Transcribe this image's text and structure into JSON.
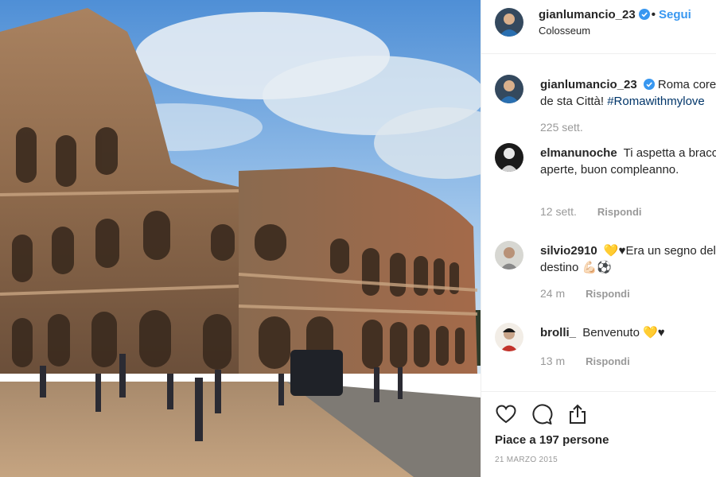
{
  "post": {
    "username": "gianlumancio_23",
    "follow_label": "Segui",
    "separator": "•",
    "location": "Colosseum",
    "caption_user": "gianlumancio_23",
    "caption_text": "Roma core de sta Città!",
    "caption_tag": "#Romawithmylove",
    "caption_time": "225 sett."
  },
  "comments": [
    {
      "user": "elmanunoche",
      "text": "Ti aspetta a braccia aperte, buon compleanno.",
      "time": "12 sett.",
      "reply_label": "Rispondi"
    },
    {
      "user": "silvio2910",
      "text": "💛♥Era un segno del destino 💪🏻⚽",
      "time": "24 m",
      "reply_label": "Rispondi"
    },
    {
      "user": "brolli_",
      "text": "Benvenuto 💛♥",
      "time": "13 m",
      "reply_label": "Rispondi"
    }
  ],
  "footer": {
    "likes": "Piace a 197 persone",
    "date": "21 MARZO 2015"
  },
  "icons": [
    "verified-badge-icon",
    "heart-icon",
    "comment-icon",
    "share-icon"
  ],
  "colors": {
    "link": "#3897f0",
    "tag": "#003569",
    "muted": "#999999",
    "text": "#262626"
  }
}
